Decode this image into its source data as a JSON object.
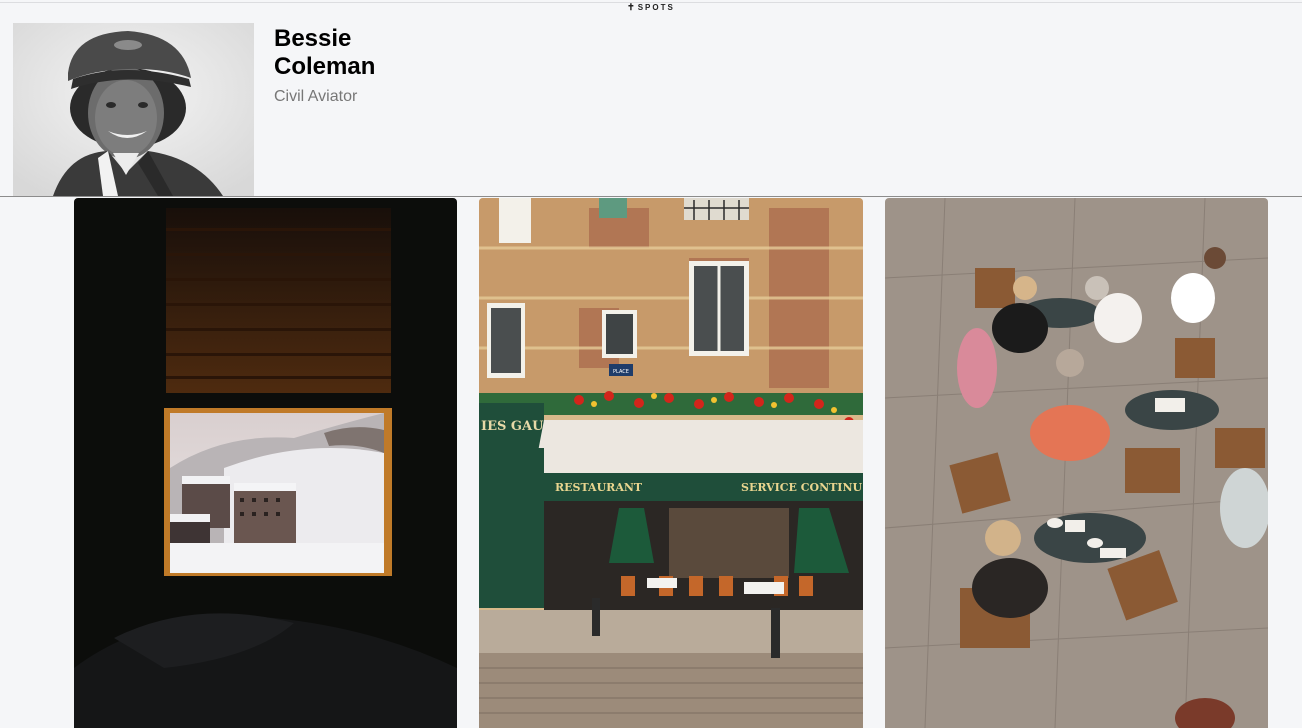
{
  "brand": {
    "mark": "✝",
    "label": "SPOTS"
  },
  "profile": {
    "name": "Bessie Coleman",
    "role": "Civil Aviator"
  },
  "photos": {
    "tile_1": "",
    "tile_2_signs": {
      "restaurant": "RESTAURANT",
      "service": "SERVICE CONTINU",
      "shop": "IES GAUBERT",
      "street_plate": "PLACE"
    },
    "tile_3": ""
  },
  "colors": {
    "background": "#f5f6f8",
    "awning_green": "#1f4e3a",
    "text_muted": "#777777"
  }
}
